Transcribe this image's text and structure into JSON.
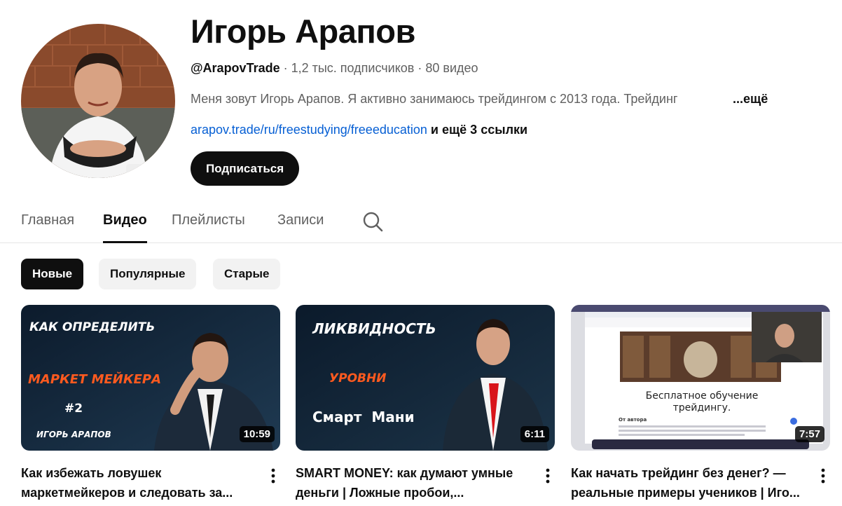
{
  "channel": {
    "name": "Игорь Арапов",
    "handle": "@ArapovTrade",
    "separator": " · ",
    "subscribers": "1,2 тыс. подписчиков",
    "video_count": "80 видео",
    "description": "Меня зовут Игорь Арапов. Я активно занимаюсь  трейдингом с 2013 года. Трейдинг",
    "description_more": "...ещё",
    "link": "arapov.trade/ru/freestudying/freeeducation",
    "more_links": "и ещё 3 ссылки",
    "subscribe_label": "Подписаться"
  },
  "tabs": [
    "Главная",
    "Видео",
    "Плейлисты",
    "Записи"
  ],
  "active_tab": "Видео",
  "chips": [
    "Новые",
    "Популярные",
    "Старые"
  ],
  "active_chip": "Новые",
  "videos": [
    {
      "title": "Как избежать ловушек маркетмейкеров и следовать за...",
      "duration": "10:59",
      "thumb_lines": [
        "КАК ОПРЕДЕЛИТЬ",
        "МАРКЕТ МЕЙКЕРА",
        "#2",
        "ИГОРЬ АРАПОВ"
      ]
    },
    {
      "title": "SMART MONEY: как думают умные деньги | Ложные пробои,...",
      "duration": "6:11",
      "thumb_lines": [
        "ЛИКВИДНОСТЬ",
        "УРОВНИ",
        "Смарт  Мани"
      ]
    },
    {
      "title": "Как начать трейдинг без денег? — реальные примеры учеников | Иго...",
      "duration": "7:57",
      "thumb_lines": [
        "Бесплатное обучение трейдингу.",
        "От автора"
      ]
    }
  ],
  "colors": {
    "accent_link": "#065fd4",
    "primary": "#0f0f0f",
    "secondary_text": "#606060",
    "chip_bg": "#f2f2f2",
    "thumb_highlight": "#ff5a1f"
  },
  "icons": [
    "search-icon",
    "more-vert-icon"
  ]
}
